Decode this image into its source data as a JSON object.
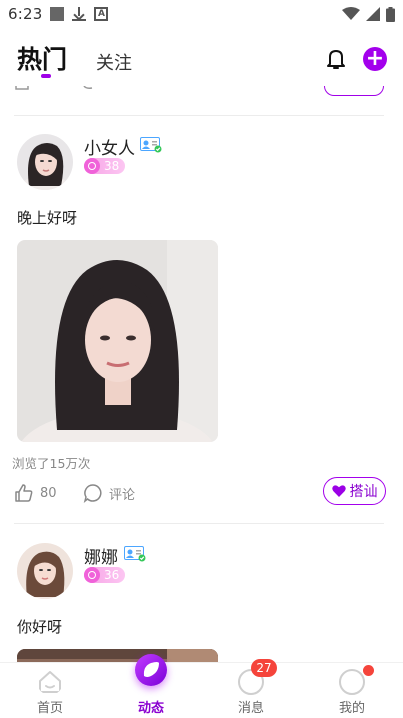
{
  "status_bar": {
    "time": "6:23"
  },
  "header": {
    "tab_hot": "热门",
    "tab_follow": "关注"
  },
  "posts": [
    {
      "username": "小女人",
      "level": "38",
      "text": "晚上好呀",
      "views": "浏览了15万次",
      "likes": "80",
      "comment_label": "评论",
      "chat_label": "搭讪"
    },
    {
      "username": "娜娜",
      "level": "36",
      "text": "你好呀"
    }
  ],
  "tabbar": {
    "home": "首页",
    "feed": "动态",
    "messages": "消息",
    "messages_badge": "27",
    "mine": "我的"
  },
  "colors": {
    "accent": "#a300ec",
    "badge_red": "#f5443b",
    "level_pink": "#f062d9"
  }
}
